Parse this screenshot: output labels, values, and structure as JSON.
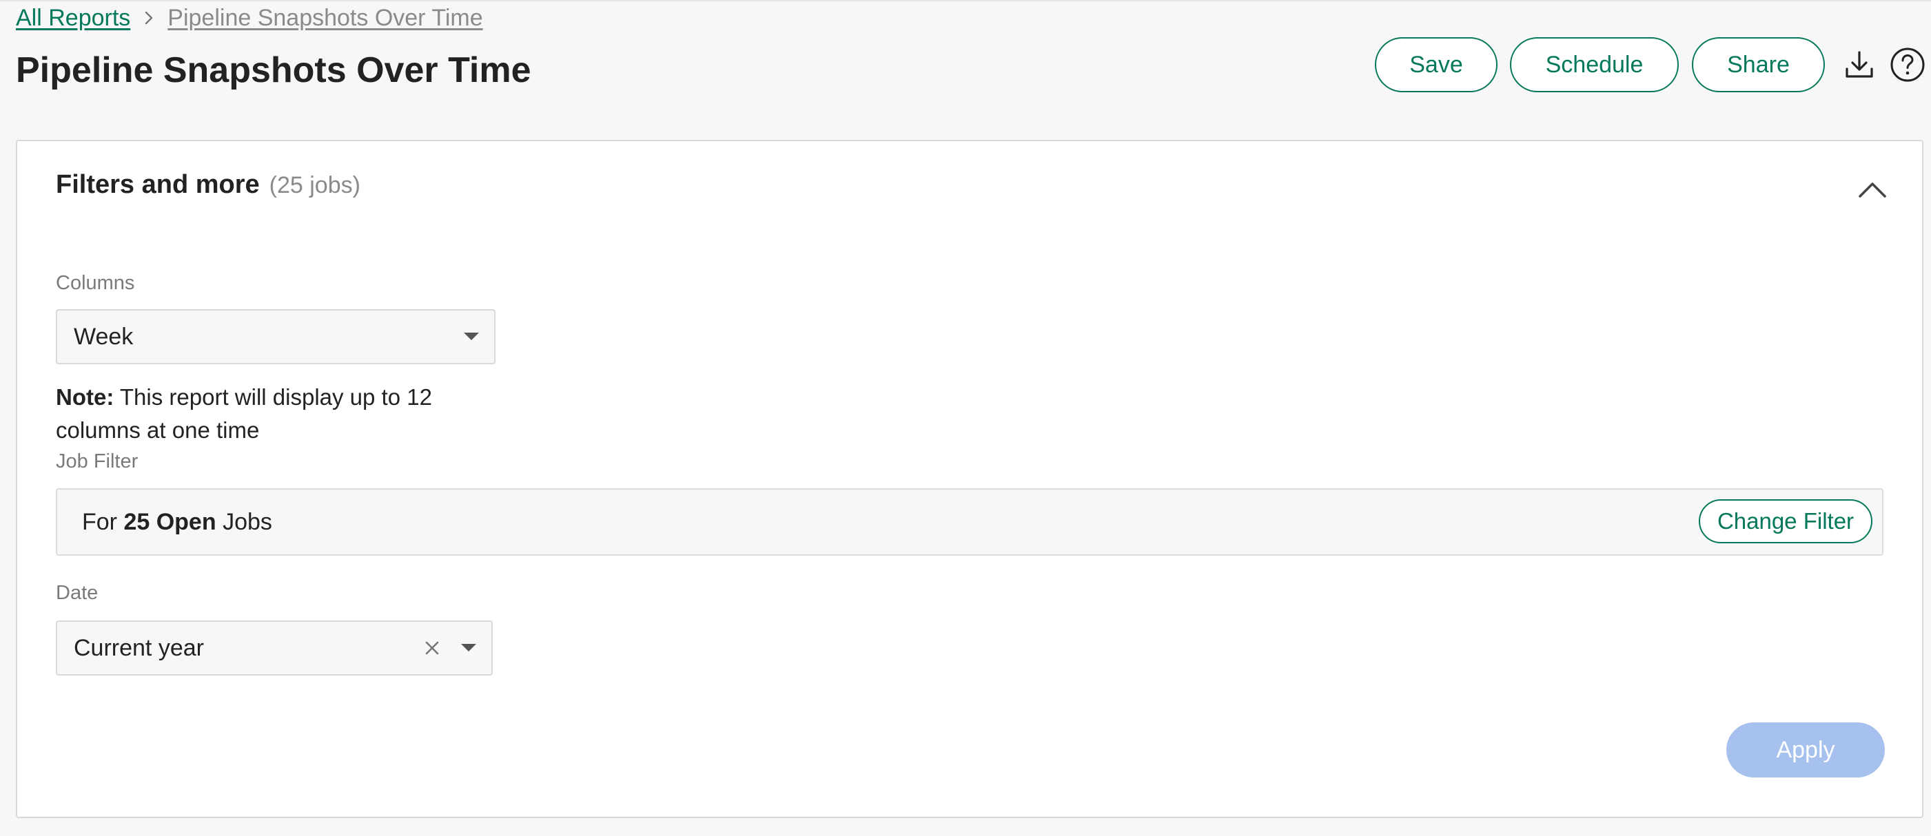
{
  "breadcrumb": {
    "root_label": "All Reports",
    "separator_icon": "chevron-right-icon",
    "current_label": "Pipeline Snapshots Over Time"
  },
  "page": {
    "title": "Pipeline Snapshots Over Time"
  },
  "header_actions": {
    "save_label": "Save",
    "schedule_label": "Schedule",
    "share_label": "Share",
    "download_icon": "download-icon",
    "help_icon": "help-icon"
  },
  "filters": {
    "title": "Filters and more",
    "count_text": "(25 jobs)",
    "collapse_icon": "chevron-up-icon",
    "columns": {
      "label": "Columns",
      "selected": "Week"
    },
    "note": {
      "prefix": "Note:",
      "text": " This report will display up to 12 columns at one time"
    },
    "job_filter": {
      "label": "Job Filter",
      "prefix": "For ",
      "count": "25 Open",
      "suffix": " Jobs",
      "change_label": "Change Filter"
    },
    "date": {
      "label": "Date",
      "selected": "Current year",
      "clear_icon": "clear-icon"
    },
    "apply_label": "Apply"
  },
  "colors": {
    "accent": "#04785a",
    "apply_disabled": "#a6c1ee",
    "background": "#f7f7f7",
    "border": "#d9d9d9"
  }
}
